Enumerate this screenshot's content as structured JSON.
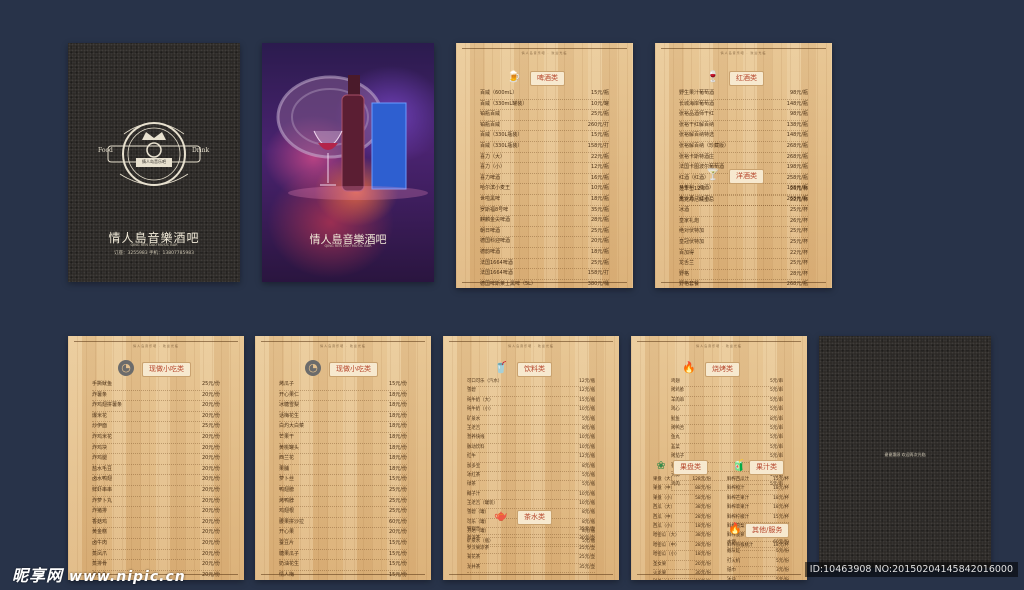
{
  "cover": {
    "badge_left": "Food",
    "badge_right": "Drink",
    "badge_center": "情人岛音乐吧",
    "title": "情人島音樂酒吧",
    "english": "QING REN DAO MUSIC BAR",
    "contact": "订座：3255983   手机：13807785983"
  },
  "poster": {
    "title": "情人島音樂酒吧",
    "subtitle": "QING REN DAO MUSIC BAR"
  },
  "menu_note": "情人岛音乐吧 · 欢迎光临",
  "sections": {
    "beer": {
      "label": "啤酒类",
      "items": [
        [
          "百威（600mL）",
          "15元/瓶"
        ],
        [
          "百威（330mL罐装）",
          "10元/罐"
        ],
        [
          "铂瓶百威",
          "25元/瓶"
        ],
        [
          "铂瓶百威",
          "260元/打"
        ],
        [
          "百威（330L瓶装）",
          "15元/瓶"
        ],
        [
          "百威（330L瓶装）",
          "158元/打"
        ],
        [
          "喜力（大）",
          "22元/瓶"
        ],
        [
          "喜力（小）",
          "12元/瓶"
        ],
        [
          "喜力啤酒",
          "16元/瓶"
        ],
        [
          "哈尔滨小麦王",
          "10元/瓶"
        ],
        [
          "世啦黑啤",
          "18元/瓶"
        ],
        [
          "罗斯福8号啤",
          "35元/瓶"
        ],
        [
          "麒麟金尖啤酒",
          "28元/瓶"
        ],
        [
          "朝日啤酒",
          "25元/瓶"
        ],
        [
          "德国科迎啤酒",
          "20元/瓶"
        ],
        [
          "德韵啤酒",
          "18元/瓶"
        ],
        [
          "法国1664啤酒",
          "25元/瓶"
        ],
        [
          "法国1664啤酒",
          "158元/打"
        ],
        [
          "德国啤斯莱士黑啤（5L）",
          "380元/桶"
        ]
      ]
    },
    "red_wine": {
      "label": "红酒类",
      "items": [
        [
          "野生果汁葡萄酒",
          "98元/瓶"
        ],
        [
          "长城海岸葡萄酒",
          "148元/瓶"
        ],
        [
          "张裕品酒师干红",
          "98元/瓶"
        ],
        [
          "张裕干红解百纳",
          "138元/瓶"
        ],
        [
          "张裕解百纳特选",
          "148元/瓶"
        ],
        [
          "张裕解百纳（珍藏版）",
          "268元/瓶"
        ],
        [
          "张裕卡斯特酒庄",
          "268元/瓶"
        ],
        [
          "法国卡图波尔葡萄酒",
          "198元/瓶"
        ],
        [
          "红酒（红酒）",
          "258元/瓶"
        ],
        [
          "马爹利（红酒）",
          "168元/瓶"
        ],
        [
          "金沙酒（红酒）",
          "268元/瓶"
        ]
      ]
    },
    "spirits": {
      "label": "洋酒类",
      "items": [
        [
          "芝华士12年",
          "26元/杯"
        ],
        [
          "杰克丹尼威士忌",
          "22元/杯"
        ],
        [
          "冰酒",
          "25元/杯"
        ],
        [
          "皇家礼炮",
          "26元/杯"
        ],
        [
          "绝对伏特加",
          "25元/杯"
        ],
        [
          "皇冠伏特加",
          "25元/杯"
        ],
        [
          "百加得",
          "22元/杯"
        ],
        [
          "龙舌兰",
          "25元/杯"
        ],
        [
          "野格",
          "28元/杯"
        ],
        [
          "野格套餐",
          "268元/瓶"
        ],
        [
          "轩尼诗VSOP",
          "380元/瓶"
        ],
        [
          "芝华士18年",
          "400元/瓶"
        ],
        [
          "百利甜酒",
          "228元/瓶"
        ]
      ]
    },
    "snack1": {
      "label": "现做小吃类",
      "items": [
        [
          "手撕鱿鱼",
          "25元/份"
        ],
        [
          "炸薯条",
          "20元/份"
        ],
        [
          "炸鸡翅拼薯条",
          "20元/份"
        ],
        [
          "爆米花",
          "20元/份"
        ],
        [
          "炒伊面",
          "25元/份"
        ],
        [
          "炸鸡米花",
          "20元/份"
        ],
        [
          "炸鸡块",
          "20元/份"
        ],
        [
          "炸鸡腿",
          "20元/份"
        ],
        [
          "盐水毛豆",
          "20元/份"
        ],
        [
          "卤水鸭翅",
          "20元/份"
        ],
        [
          "鲜虾串串",
          "20元/份"
        ],
        [
          "炸萝卜丸",
          "20元/份"
        ],
        [
          "炸猪排",
          "20元/份"
        ],
        [
          "香菇鸡",
          "20元/份"
        ],
        [
          "黄金糕",
          "20元/份"
        ],
        [
          "卤牛肉",
          "20元/份"
        ],
        [
          "蒸凤爪",
          "20元/份"
        ],
        [
          "蒸排骨",
          "20元/份"
        ],
        [
          "炸鱼丸",
          "20元/份"
        ],
        [
          "炸虾球",
          "20元/份"
        ],
        [
          "卤鸡爪",
          "20元/份"
        ],
        [
          "小炒肉",
          "20元/份"
        ]
      ]
    },
    "snack2": {
      "label": "现做小吃类",
      "items": [
        [
          "烤瓜子",
          "15元/份"
        ],
        [
          "开心果仁",
          "18元/份"
        ],
        [
          "冰糖雪梨",
          "18元/份"
        ],
        [
          "话梅花生",
          "18元/份"
        ],
        [
          "白灼大白菜",
          "18元/份"
        ],
        [
          "芒果干",
          "18元/份"
        ],
        [
          "黄桃罐头",
          "18元/份"
        ],
        [
          "西兰花",
          "18元/份"
        ],
        [
          "果脯",
          "18元/份"
        ],
        [
          "萝卜丝",
          "15元/份"
        ],
        [
          "鸭翅膀",
          "25元/份"
        ],
        [
          "烤鸭脖",
          "25元/份"
        ],
        [
          "鸡翅根",
          "25元/份"
        ],
        [
          "腰果拼沙拉",
          "60元/份"
        ],
        [
          "开心果",
          "20元/份"
        ],
        [
          "蚕豆片",
          "15元/份"
        ],
        [
          "糖果瓜子",
          "15元/份"
        ],
        [
          "奶油花生",
          "15元/份"
        ],
        [
          "情人梅",
          "15元/份"
        ],
        [
          "杨梅干",
          "15元/份"
        ],
        [
          "话梅",
          "15元/份"
        ],
        [
          "牛肉干",
          "35元/份"
        ]
      ]
    },
    "drinks": {
      "label": "饮料类",
      "items": [
        [
          "可口可乐（汽水）",
          "12元/瓶"
        ],
        [
          "雪碧",
          "12元/瓶"
        ],
        [
          "纯牛奶（大）",
          "15元/瓶"
        ],
        [
          "纯牛奶（小）",
          "10元/瓶"
        ],
        [
          "矿泉水",
          "5元/瓶"
        ],
        [
          "王老吉",
          "8元/瓶"
        ],
        [
          "营养快线",
          "10元/瓶"
        ],
        [
          "脉动饮料",
          "10元/瓶"
        ],
        [
          "红牛",
          "12元/瓶"
        ],
        [
          "加多宝",
          "8元/瓶"
        ],
        [
          "冰红茶",
          "5元/瓶"
        ],
        [
          "绿茶",
          "5元/瓶"
        ],
        [
          "椰子汁",
          "10元/瓶"
        ],
        [
          "王老吉（罐装）",
          "10元/瓶"
        ],
        [
          "雪碧（罐）",
          "8元/瓶"
        ],
        [
          "可乐（罐）",
          "8元/瓶"
        ],
        [
          "芬达（罐）",
          "8元/瓶"
        ],
        [
          "矿泉水（瓶）",
          "5元/瓶"
        ]
      ]
    },
    "tea": {
      "label": "茶水类",
      "items": [
        [
          "铁观音",
          "35元/壶"
        ],
        [
          "普洱茶",
          "30元/壶"
        ],
        [
          "罗汉果凉茶",
          "25元/壶"
        ],
        [
          "菊花茶",
          "25元/壶"
        ],
        [
          "龙井茶",
          "35元/壶"
        ]
      ]
    },
    "bbq": {
      "label": "烧烤类",
      "items": [
        [
          "鸡翅",
          "5元/串"
        ],
        [
          "烤鸡胗",
          "5元/串"
        ],
        [
          "羊肉串",
          "5元/串"
        ],
        [
          "鸡心",
          "5元/串"
        ],
        [
          "鱿鱼",
          "8元/串"
        ],
        [
          "烤鸭舌",
          "5元/串"
        ],
        [
          "鱼丸",
          "5元/串"
        ],
        [
          "韭菜",
          "5元/串"
        ],
        [
          "烤茄子",
          "5元/串"
        ],
        [
          "香肠",
          "5元/串"
        ],
        [
          "大蒜",
          "5元/串"
        ],
        [
          "鸡肉",
          "5元/串"
        ]
      ]
    },
    "fruit": {
      "label": "果盘类",
      "items": [
        [
          "果盘（大）",
          "128元/份"
        ],
        [
          "果盘（中）",
          "88元/份"
        ],
        [
          "果盘（小）",
          "58元/份"
        ],
        [
          "西瓜（大）",
          "38元/份"
        ],
        [
          "西瓜（中）",
          "28元/份"
        ],
        [
          "西瓜（小）",
          "18元/份"
        ],
        [
          "哈密瓜（大）",
          "38元/份"
        ],
        [
          "哈密瓜（中）",
          "28元/份"
        ],
        [
          "哈密瓜（小）",
          "18元/份"
        ],
        [
          "圣女果",
          "20元/份"
        ],
        [
          "火龙果",
          "30元/份"
        ],
        [
          "拼盘（大）",
          "98元/份"
        ],
        [
          "拼盘（小）",
          "68元/份"
        ]
      ]
    },
    "juice": {
      "label": "果汁类",
      "items": [
        [
          "鲜榨西瓜汁",
          "15元/杯"
        ],
        [
          "鲜榨橙汁",
          "18元/杯"
        ],
        [
          "鲜榨芒果汁",
          "18元/杯"
        ],
        [
          "鲜榨苹果汁",
          "18元/杯"
        ],
        [
          "鲜榨柠檬汁",
          "15元/杯"
        ],
        [
          "鲜榨雪梨汁",
          "15元/杯"
        ],
        [
          "鲜榨菠萝汁",
          "15元/杯"
        ],
        [
          "鲜榨猕猴桃汁",
          "18元/杯"
        ]
      ]
    },
    "other": {
      "label": "其他/服务",
      "items": [
        [
          "水烟",
          "60元/份"
        ],
        [
          "烟灰缸",
          "5元/份"
        ],
        [
          "打火机",
          "5元/份"
        ],
        [
          "纸巾",
          "3元/份"
        ],
        [
          "冰块",
          "5元/份"
        ]
      ]
    }
  },
  "back_cover_note": "谢谢惠顾 欢迎再次光临",
  "watermark": {
    "brand": "昵享网",
    "url": "www.nipic.cn",
    "id": "ID:10463908 NO:20150204145842016000"
  }
}
